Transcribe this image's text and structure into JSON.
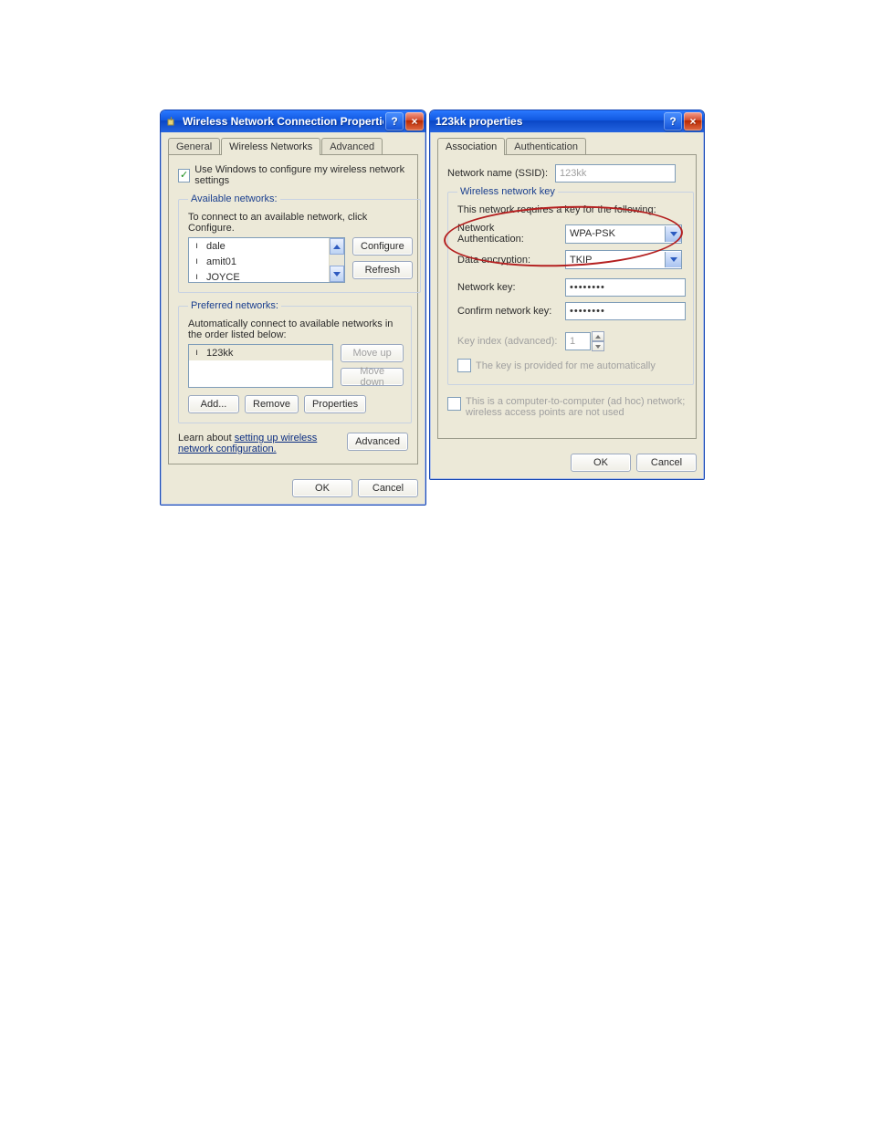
{
  "dialog1": {
    "title": "Wireless Network Connection Properties",
    "tabs": {
      "general": "General",
      "wireless": "Wireless Networks",
      "advanced": "Advanced"
    },
    "use_windows_label": "Use Windows to configure my wireless network settings",
    "available": {
      "legend": "Available networks:",
      "hint": "To connect to an available network, click Configure.",
      "items": [
        "dale",
        "amit01",
        "JOYCE"
      ],
      "configure": "Configure",
      "refresh": "Refresh"
    },
    "preferred": {
      "legend": "Preferred networks:",
      "hint": "Automatically connect to available networks in the order listed below:",
      "items": [
        "123kk"
      ],
      "move_up": "Move up",
      "move_down": "Move down",
      "add": "Add...",
      "remove": "Remove",
      "properties": "Properties"
    },
    "learn_prefix": "Learn about ",
    "learn_link": "setting up wireless network configuration.",
    "advanced_btn": "Advanced",
    "ok": "OK",
    "cancel": "Cancel"
  },
  "dialog2": {
    "title": "123kk properties",
    "tabs": {
      "association": "Association",
      "authentication": "Authentication"
    },
    "ssid_label": "Network name (SSID):",
    "ssid_value": "123kk",
    "key": {
      "legend": "Wireless network key",
      "requires": "This network requires a key for the following:",
      "auth_label": "Network Authentication:",
      "auth_value": "WPA-PSK",
      "enc_label": "Data encryption:",
      "enc_value": "TKIP",
      "key_label": "Network key:",
      "key_value": "••••••••",
      "confirm_label": "Confirm network key:",
      "confirm_value": "••••••••",
      "index_label": "Key index (advanced):",
      "index_value": "1",
      "auto_label": "The key is provided for me automatically"
    },
    "adhoc_label": "This is a computer-to-computer (ad hoc) network; wireless access points are not used",
    "ok": "OK",
    "cancel": "Cancel"
  }
}
